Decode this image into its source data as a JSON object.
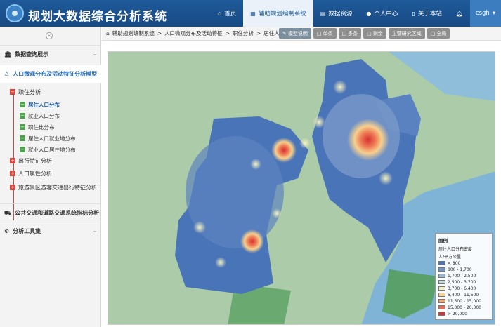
{
  "header": {
    "title": "规划大数据综合分析系统",
    "nav": [
      {
        "label": "首页",
        "icon": "home-icon"
      },
      {
        "label": "辅助规划编制系统",
        "icon": "grid-icon"
      },
      {
        "label": "数据资源",
        "icon": "database-icon"
      },
      {
        "label": "个人中心",
        "icon": "user-icon"
      },
      {
        "label": "关于本站",
        "icon": "file-icon"
      },
      {
        "label": "",
        "icon": "bell-icon"
      }
    ],
    "user": "csgh"
  },
  "sidebar": {
    "collapse_glyph": "«",
    "sections": [
      {
        "label": "数据查询展示"
      },
      {
        "label": "人口微观分布及活动特征分析模型"
      },
      {
        "label": "公共交通和道路交通系统指标分析"
      },
      {
        "label": "分析工具集"
      }
    ],
    "subs": [
      "职住分析",
      "出行特征分析",
      "人口属性分析",
      "旅游景区游客交通出行特征分析"
    ],
    "leaves": [
      "居住人口分布",
      "就业人口分布",
      "职住比分布",
      "居住人口就业地分布",
      "就业人口居住地分布"
    ]
  },
  "breadcrumb": [
    "辅助规划编制系统",
    "人口微观分布及活动特征",
    "职住分析",
    "居住人口分布"
  ],
  "toolbar": [
    {
      "label": "模型说明"
    },
    {
      "label": "单条"
    },
    {
      "label": "多条"
    },
    {
      "label": "剩余"
    },
    {
      "label": "主营研究区域"
    },
    {
      "label": "全局"
    }
  ],
  "legend": {
    "title": "图例",
    "subtitle": "居住人口分布密度",
    "unit": "人/平方公里",
    "classes": [
      {
        "label": "< 800",
        "color": "#4a74b8"
      },
      {
        "label": "800 - 1,700",
        "color": "#6f95c6"
      },
      {
        "label": "1,700 - 2,500",
        "color": "#98b6d2"
      },
      {
        "label": "2,500 - 3,700",
        "color": "#c3d7d9"
      },
      {
        "label": "3,700 - 6,400",
        "color": "#f4f1c3"
      },
      {
        "label": "6,400 - 11,500",
        "color": "#f7d08e"
      },
      {
        "label": "11,500 - 15,000",
        "color": "#f2a46c"
      },
      {
        "label": "15,000 - 20,000",
        "color": "#e96a53"
      },
      {
        "label": "> 20,000",
        "color": "#d7302f"
      }
    ]
  }
}
